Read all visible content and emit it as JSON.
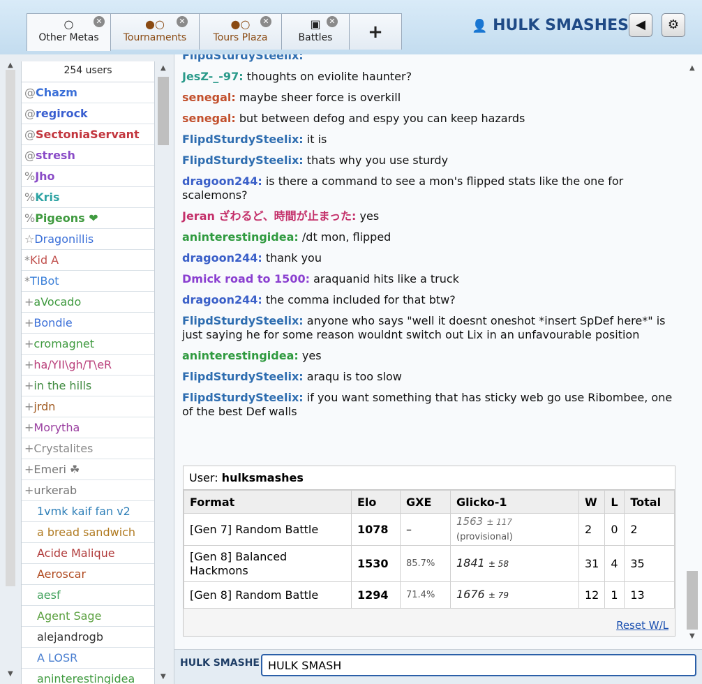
{
  "tabs": [
    {
      "label": "Other Metas",
      "icon": "chat-bubble-icon"
    },
    {
      "label": "Tournaments",
      "icon": "chat-bubbles-icon"
    },
    {
      "label": "Tours Plaza",
      "icon": "chat-bubbles-icon"
    },
    {
      "label": "Battles",
      "icon": "battle-icon"
    }
  ],
  "tab_add_label": "+",
  "header": {
    "username": "HULK SMASHES"
  },
  "userlist": {
    "count": "254 users",
    "users": [
      {
        "rank": "@",
        "name": "Chazm",
        "color": "#3a6fd8",
        "bold": true
      },
      {
        "rank": "@",
        "name": "regirock",
        "color": "#3a5fd0",
        "bold": true
      },
      {
        "rank": "@",
        "name": "SectoniaServant",
        "color": "#c2353d",
        "bold": true
      },
      {
        "rank": "@",
        "name": "stresh",
        "color": "#8a4cc7",
        "bold": true
      },
      {
        "rank": "%",
        "name": "Jho",
        "color": "#8a4cc7",
        "bold": true
      },
      {
        "rank": "%",
        "name": "Kris",
        "color": "#2ea3a3",
        "bold": true
      },
      {
        "rank": "%",
        "name": "Pigeons ❤",
        "color": "#3f9a3f",
        "bold": true
      },
      {
        "rank": "☆",
        "name": "Dragonillis",
        "color": "#3a6fd8",
        "bold": false
      },
      {
        "rank": "*",
        "name": "Kid A",
        "color": "#c0504d",
        "bold": false
      },
      {
        "rank": "*",
        "name": "TIBot",
        "color": "#3a7fd8",
        "bold": false
      },
      {
        "rank": "+",
        "name": "aVocado",
        "color": "#3f9a3f",
        "bold": false
      },
      {
        "rank": "+",
        "name": "Bondie",
        "color": "#3a6fd8",
        "bold": false
      },
      {
        "rank": "+",
        "name": "cromagnet",
        "color": "#3f9a3f",
        "bold": false
      },
      {
        "rank": "+",
        "name": "ha/YII\\gh/T\\eR",
        "color": "#b93f7a",
        "bold": false
      },
      {
        "rank": "+",
        "name": "in the hills",
        "color": "#3f8a3f",
        "bold": false
      },
      {
        "rank": "+",
        "name": "jrdn",
        "color": "#a05a20",
        "bold": false
      },
      {
        "rank": "+",
        "name": "Morytha",
        "color": "#9a3fa0",
        "bold": false
      },
      {
        "rank": "+",
        "name": "Crystalites",
        "color": "#8a8a8a",
        "bold": false
      },
      {
        "rank": "+",
        "name": "Emeri ☘",
        "color": "#777777",
        "bold": false
      },
      {
        "rank": "+",
        "name": "urkerab",
        "color": "#777777",
        "bold": false
      },
      {
        "rank": "",
        "name": "1vmk kaif fan v2",
        "color": "#2e7fb8",
        "bold": false
      },
      {
        "rank": "",
        "name": "a bread sandwich",
        "color": "#b07a20",
        "bold": false
      },
      {
        "rank": "",
        "name": "Acide Malique",
        "color": "#b03a3a",
        "bold": false
      },
      {
        "rank": "",
        "name": "Aeroscar",
        "color": "#b04a20",
        "bold": false
      },
      {
        "rank": "",
        "name": "aesf",
        "color": "#3fa05a",
        "bold": false
      },
      {
        "rank": "",
        "name": "Agent Sage",
        "color": "#5aa03f",
        "bold": false
      },
      {
        "rank": "",
        "name": "alejandrogb",
        "color": "#333333",
        "bold": false
      },
      {
        "rank": "",
        "name": "A LOSR",
        "color": "#4a7fd0",
        "bold": false
      },
      {
        "rank": "",
        "name": "aninterestingidea",
        "color": "#3f9a3f",
        "bold": false
      }
    ]
  },
  "chat": {
    "messages": [
      {
        "user": "FlipdSturdySteelix:",
        "color": "#2e6db0",
        "text": ""
      },
      {
        "user": "JesZ-_-97:",
        "color": "#2a9a8a",
        "text": "thoughts on eviolite haunter?"
      },
      {
        "user": "senegal:",
        "color": "#c2502d",
        "text": "maybe sheer force is overkill"
      },
      {
        "user": "senegal:",
        "color": "#c2502d",
        "text": "but between defog and espy you can keep hazards"
      },
      {
        "user": "FlipdSturdySteelix:",
        "color": "#2e6db0",
        "text": "it is"
      },
      {
        "user": "FlipdSturdySteelix:",
        "color": "#2e6db0",
        "text": "thats why you use sturdy"
      },
      {
        "user": "dragoon244:",
        "color": "#3a5fc8",
        "text": "is there a command to see a mon's flipped stats like the one for scalemons?"
      },
      {
        "user": "Jeran ざわるど、時間が止まった:",
        "color": "#c4306a",
        "text": "yes"
      },
      {
        "user": "aninterestingidea:",
        "color": "#2f9a3f",
        "text": "/dt mon, flipped"
      },
      {
        "user": "dragoon244:",
        "color": "#3a5fc8",
        "text": "thank you"
      },
      {
        "user": "Dmick road to 1500:",
        "color": "#8a3fd0",
        "text": "araquanid hits like a truck"
      },
      {
        "user": "dragoon244:",
        "color": "#3a5fc8",
        "text": "the comma included for that btw?"
      },
      {
        "user": "FlipdSturdySteelix:",
        "color": "#2e6db0",
        "text": "anyone who says \"well it doesnt oneshot *insert SpDef here*\" is just saying he for some reason wouldnt switch out Lix in an unfavourable position"
      },
      {
        "user": "aninterestingidea:",
        "color": "#2f9a3f",
        "text": "yes"
      },
      {
        "user": "FlipdSturdySteelix:",
        "color": "#2e6db0",
        "text": "araqu is too slow"
      },
      {
        "user": "FlipdSturdySteelix:",
        "color": "#2e6db0",
        "text": "if you want something that has sticky web go use Ribombee, one of the best Def walls"
      }
    ]
  },
  "rating": {
    "user_label": "User:",
    "user": "hulksmashes",
    "headers": [
      "Format",
      "Elo",
      "GXE",
      "Glicko-1",
      "W",
      "L",
      "Total"
    ],
    "rows": [
      {
        "format": "[Gen 7] Random Battle",
        "elo": "1078",
        "gxe": "–",
        "glicko": "1563",
        "dev": "± 117",
        "note": "(provisional)",
        "w": "2",
        "l": "0",
        "total": "2"
      },
      {
        "format": "[Gen 8] Balanced Hackmons",
        "elo": "1530",
        "gxe": "85.7%",
        "glicko": "1841",
        "dev": "± 58",
        "note": "",
        "w": "31",
        "l": "4",
        "total": "35"
      },
      {
        "format": "[Gen 8] Random Battle",
        "elo": "1294",
        "gxe": "71.4%",
        "glicko": "1676",
        "dev": "± 79",
        "note": "",
        "w": "12",
        "l": "1",
        "total": "13"
      }
    ],
    "reset_label": "Reset W/L"
  },
  "input": {
    "label": "HULK SMASHES:",
    "value": "HULK SMASH"
  }
}
